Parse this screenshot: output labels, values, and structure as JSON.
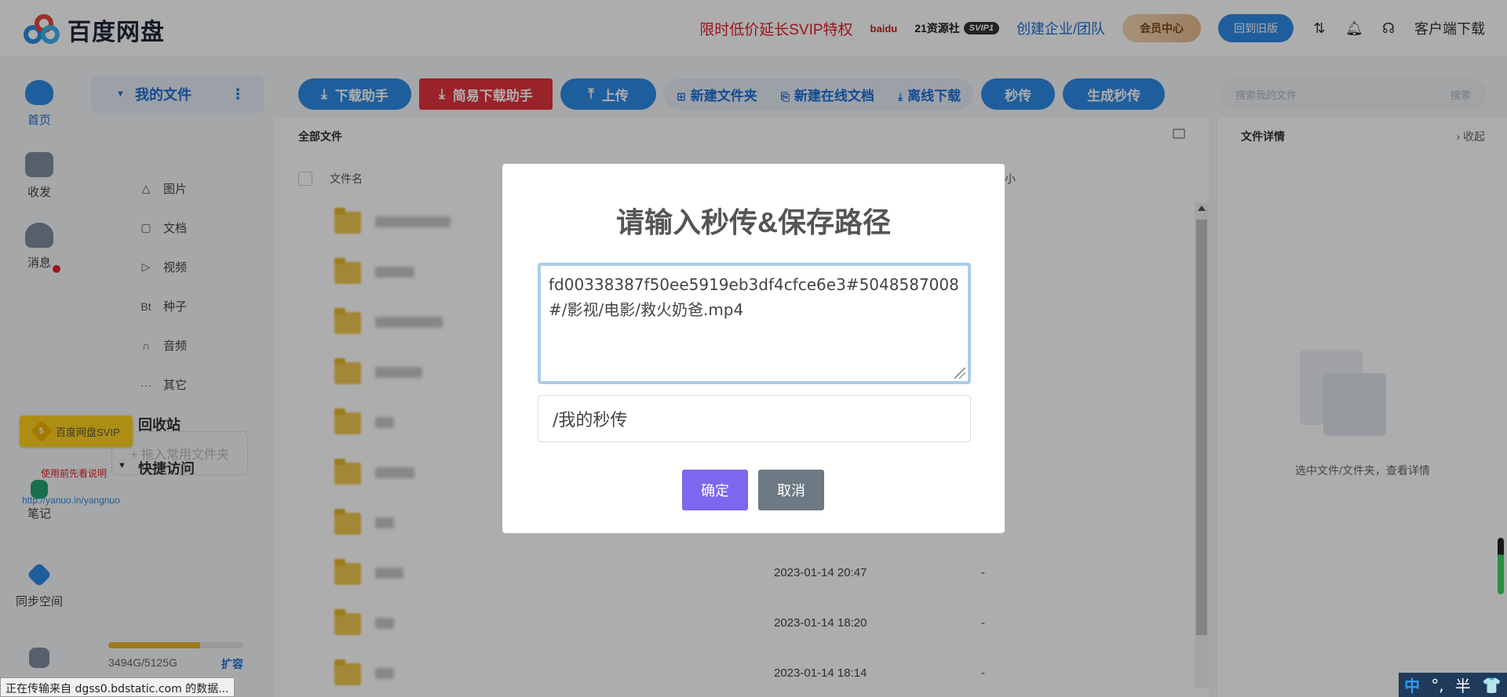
{
  "app": {
    "name": "百度网盘"
  },
  "topbar": {
    "promo": "限时低价延长SVIP特权",
    "small_logo": "baidu",
    "res21_label": "21资源社",
    "res21_badge": "SVIP1",
    "enterprise": "创建企业/团队",
    "vip_center": "会员中心",
    "back_old": "回到旧版",
    "client_download": "客户端下载"
  },
  "rail": {
    "items": [
      {
        "label": "首页",
        "icon": "cloud-icon"
      },
      {
        "label": "收发",
        "icon": "share-icon"
      },
      {
        "label": "消息",
        "icon": "people-icon"
      },
      {
        "label": "笔记",
        "icon": "note-icon"
      },
      {
        "label": "同步空间",
        "icon": "sync-icon"
      }
    ]
  },
  "sidebar": {
    "my_files": "我的文件",
    "categories": [
      {
        "icon": "△",
        "label": "图片"
      },
      {
        "icon": "▢",
        "label": "文档"
      },
      {
        "icon": "▷",
        "label": "视频"
      },
      {
        "icon": "Bt",
        "label": "种子"
      },
      {
        "icon": "∩",
        "label": "音频"
      },
      {
        "icon": "···",
        "label": "其它"
      }
    ],
    "recycle": "回收站",
    "quick_access": "快捷访问",
    "drag_hint": "+ 拖入常用文件夹",
    "quota_text": "3494G/5125G",
    "quota_fraction": 0.68,
    "expand": "扩容"
  },
  "addons": {
    "svip_badge": "百度网盘SVIP",
    "hint": "使用前先看说明",
    "link": "http://yanuo.in/yangnuo"
  },
  "toolbar": {
    "download_helper": "下载助手",
    "simple_download": "简易下载助手",
    "upload": "上传",
    "new_folder": "新建文件夹",
    "new_online_doc": "新建在线文档",
    "offline_download": "离线下载",
    "instant": "秒传",
    "gen_instant": "生成秒传",
    "search_placeholder": "搜索我的文件",
    "search_btn": "搜索"
  },
  "main": {
    "breadcrumb": "全部文件",
    "col_name": "文件名",
    "col_size": "小",
    "rows": [
      {
        "date": "",
        "size": ""
      },
      {
        "date": "",
        "size": ""
      },
      {
        "date": "",
        "size": ""
      },
      {
        "date": "",
        "size": ""
      },
      {
        "date": "",
        "size": ""
      },
      {
        "date": "",
        "size": ""
      },
      {
        "date": "",
        "size": ""
      },
      {
        "date": "2023-01-14 20:47",
        "size": "-"
      },
      {
        "date": "2023-01-14 18:20",
        "size": "-"
      },
      {
        "date": "2023-01-14 18:14",
        "size": "-"
      }
    ]
  },
  "detail": {
    "title": "文件详情",
    "collapse": "› 收起",
    "empty": "选中文件/文件夹，查看详情"
  },
  "modal": {
    "title": "请输入秒传&保存路径",
    "code": "fd00338387f50ee5919eb3df4cfce6e3#5048587008#/影视/电影/救火奶爸.mp4",
    "path": "/我的秒传",
    "ok": "确定",
    "cancel": "取消"
  },
  "status_bar": "正在传输来自 dgss0.bdstatic.com 的数据...",
  "ime": {
    "zh": "中",
    "dot": "°,",
    "half": "半",
    "shirt": "👕"
  }
}
